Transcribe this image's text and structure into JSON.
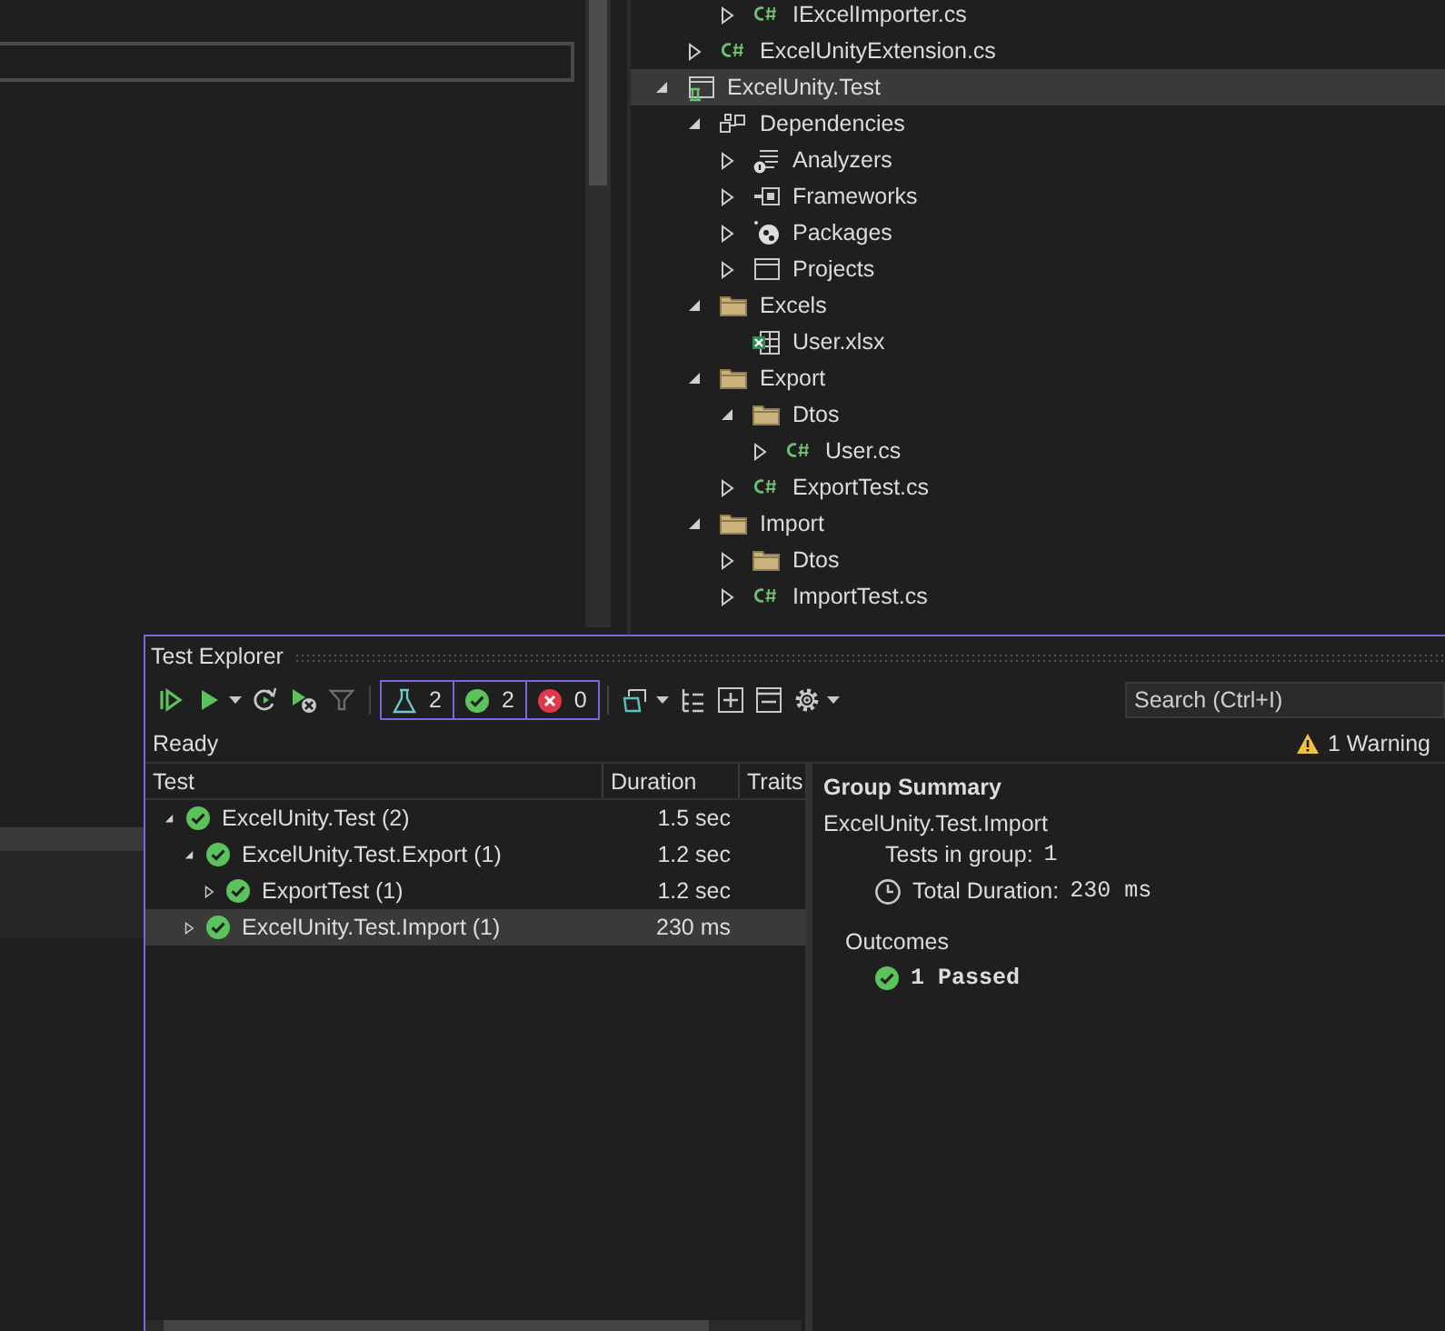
{
  "solution_explorer": {
    "tree": [
      {
        "children": [
          {
            "children": [
              {
                "label": "IExcelImporter.cs",
                "kind": "csharp",
                "expanded": false,
                "selected": false
              }
            ]
          },
          {
            "label": "ExcelUnityExtension.cs",
            "kind": "csharp",
            "expanded": false,
            "selected": false
          }
        ]
      },
      {
        "label": "ExcelUnity.Test",
        "kind": "project",
        "expanded": true,
        "selected": true,
        "children": [
          {
            "label": "Dependencies",
            "kind": "dependencies",
            "expanded": true,
            "selected": false,
            "children": [
              {
                "label": "Analyzers",
                "kind": "analyzers",
                "expanded": false,
                "selected": false
              },
              {
                "label": "Frameworks",
                "kind": "frameworks",
                "expanded": false,
                "selected": false
              },
              {
                "label": "Packages",
                "kind": "packages",
                "expanded": false,
                "selected": false
              },
              {
                "label": "Projects",
                "kind": "projects",
                "expanded": false,
                "selected": false
              }
            ]
          },
          {
            "label": "Excels",
            "kind": "folder",
            "expanded": true,
            "selected": false,
            "children": [
              {
                "label": "User.xlsx",
                "kind": "excel",
                "selected": false
              }
            ]
          },
          {
            "label": "Export",
            "kind": "folder",
            "expanded": true,
            "selected": false,
            "children": [
              {
                "label": "Dtos",
                "kind": "folder",
                "expanded": true,
                "selected": false,
                "children": [
                  {
                    "label": "User.cs",
                    "kind": "csharp",
                    "expanded": false,
                    "selected": false
                  }
                ]
              },
              {
                "label": "ExportTest.cs",
                "kind": "csharp",
                "expanded": false,
                "selected": false
              }
            ]
          },
          {
            "label": "Import",
            "kind": "folder",
            "expanded": true,
            "selected": false,
            "children": [
              {
                "label": "Dtos",
                "kind": "folder",
                "expanded": false,
                "selected": false
              },
              {
                "label": "ImportTest.cs",
                "kind": "csharp",
                "expanded": false,
                "selected": false
              }
            ]
          }
        ]
      }
    ]
  },
  "test_explorer": {
    "title": "Test Explorer",
    "toolbar": [
      {
        "kind": "run_all",
        "disabled": false
      },
      {
        "kind": "run",
        "disabled": false,
        "dropdown": true
      },
      {
        "kind": "repeat",
        "disabled": false
      },
      {
        "kind": "cancel",
        "disabled": false
      },
      {
        "kind": "filter",
        "disabled": true
      },
      {
        "kind": "counters"
      },
      {
        "kind": "playlist",
        "disabled": false,
        "dropdown": true
      },
      {
        "kind": "hierarchy",
        "disabled": false
      },
      {
        "kind": "expand_all",
        "disabled": false
      },
      {
        "kind": "collapse_all",
        "disabled": false
      },
      {
        "kind": "settings",
        "disabled": false,
        "dropdown": true
      }
    ],
    "counters": [
      {
        "kind": "total",
        "count": "2"
      },
      {
        "kind": "passed",
        "count": "2"
      },
      {
        "kind": "failed",
        "count": "0"
      }
    ],
    "search": {
      "placeholder": "Search (Ctrl+I)"
    },
    "status": "Ready",
    "warning": "1 Warning",
    "columns": [
      "Test",
      "Duration",
      "Traits"
    ],
    "tests": [
      {
        "name": "ExcelUnity.Test (2)",
        "duration": "1.5 sec",
        "passed": true,
        "expanded": true,
        "selected": false,
        "children": [
          {
            "name": "ExcelUnity.Test.Export (1)",
            "duration": "1.2 sec",
            "passed": true,
            "expanded": true,
            "selected": false,
            "children": [
              {
                "name": "ExportTest (1)",
                "duration": "1.2 sec",
                "passed": true,
                "expanded": false,
                "selected": false
              }
            ]
          },
          {
            "name": "ExcelUnity.Test.Import (1)",
            "duration": "230 ms",
            "passed": true,
            "expanded": false,
            "selected": true
          }
        ]
      }
    ],
    "summary": {
      "title": "Group Summary",
      "name": "ExcelUnity.Test.Import",
      "stats": [
        {
          "kind": "count",
          "label": "Tests in group:",
          "value": "1"
        },
        {
          "kind": "duration",
          "label": "Total Duration:",
          "value": "230 ms"
        }
      ],
      "outcomes_title": "Outcomes",
      "outcomes": [
        {
          "passed": true,
          "text": "1 Passed"
        }
      ]
    }
  }
}
